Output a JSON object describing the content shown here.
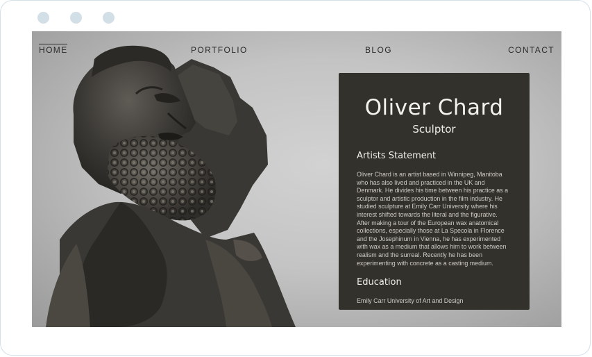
{
  "nav": {
    "home": "HOME",
    "portfolio": "PORTFOLIO",
    "blog": "BLOG",
    "contact": "CONTACT"
  },
  "profile": {
    "name": "Oliver Chard",
    "role": "Sculptor",
    "statement_heading": "Artists Statement",
    "statement": "Oliver Chard is an artist based in Winnipeg, Manitoba who has also lived and practiced in the UK and Denmark. He divides his time between his practice as a sculptor and artistic production in the film industry. He studied sculpture at Emily Carr University where his interest shifted towards the literal and the figurative. After making a tour of the European wax anatomical collections, especially those at La Specola in Florence and the Josephinum in Vienna, he has experimented with wax as a medium that allows him to work between realism and the surreal. Recently he has been experimenting with concrete as a casting medium.",
    "education_heading": "Education",
    "education_items": [
      "Emily Carr University of Art and Design"
    ]
  },
  "colors": {
    "card_background": "#32312c",
    "page_background": "#c4c4c4",
    "frame_dot": "#d3dfe7"
  }
}
